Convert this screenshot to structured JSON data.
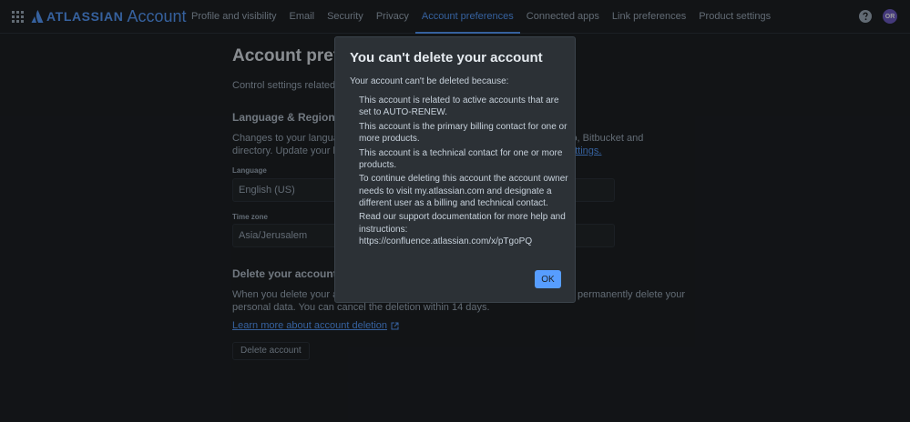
{
  "nav": {
    "logo_word": "ATLASSIAN",
    "product": "Account",
    "items": [
      {
        "label": "Profile and visibility"
      },
      {
        "label": "Email"
      },
      {
        "label": "Security"
      },
      {
        "label": "Privacy"
      },
      {
        "label": "Account preferences",
        "active": true
      },
      {
        "label": "Connected apps"
      },
      {
        "label": "Link preferences"
      },
      {
        "label": "Product settings"
      }
    ],
    "avatar_initials": "OR"
  },
  "page": {
    "title": "Account prefere",
    "description": "Control settings related to",
    "language_region": {
      "heading": "Language & Region",
      "para_left_1": "Changes to your language",
      "para_right_1": "lo, Bitbucket and",
      "para_left_2": "directory. Update your lan",
      "para_right_2_link": "ettings.",
      "language_label": "Language",
      "language_value": "English (US)",
      "timezone_label": "Time zone",
      "timezone_value": "Asia/Jerusalem"
    },
    "delete_account": {
      "heading": "Delete your account",
      "para_left_1": "When you delete your acc",
      "para_right_1": "permanently delete your",
      "para_line_2": "personal data. You can cancel the deletion within 14 days.",
      "learn_more": "Learn more about account deletion",
      "button": "Delete account"
    }
  },
  "modal": {
    "title": "You can't delete your account",
    "intro": "Your account can't be deleted because:",
    "reasons": [
      "This account is related to active accounts that are set to AUTO-RENEW.",
      "This account is the primary billing contact for one or more products.",
      "This account is a technical contact for one or more products.",
      "To continue deleting this account the account owner needs to visit my.atlassian.com and designate a different user as a billing and technical contact.",
      "Read our support documentation for more help and instructions: https://confluence.atlassian.com/x/pTgoPQ"
    ],
    "ok": "OK"
  },
  "colors": {
    "accent": "#579dff",
    "background": "#1d2125",
    "modal_bg": "#2c3136"
  }
}
